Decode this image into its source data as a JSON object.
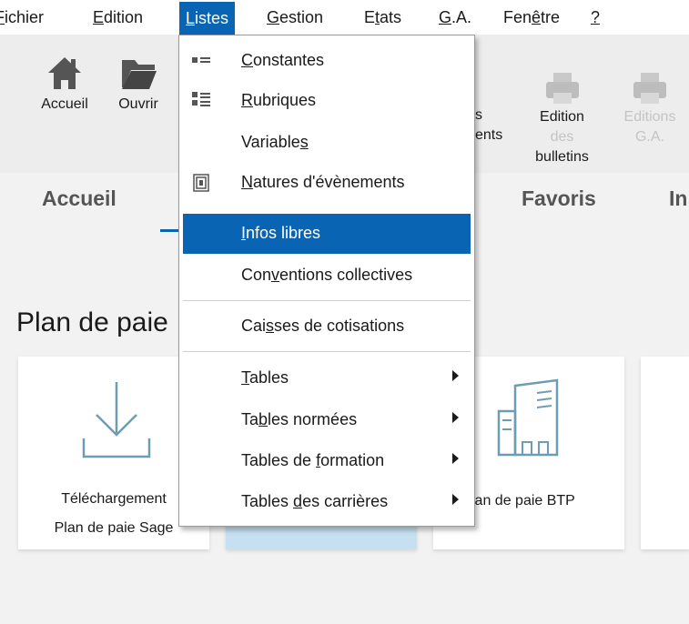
{
  "menubar": {
    "items": [
      {
        "pre": "",
        "ul": "F",
        "post": "ichier"
      },
      {
        "pre": "",
        "ul": "E",
        "post": "dition"
      },
      {
        "pre": "",
        "ul": "L",
        "post": "istes"
      },
      {
        "pre": "",
        "ul": "G",
        "post": "estion"
      },
      {
        "pre": "E",
        "ul": "t",
        "post": "ats"
      },
      {
        "pre": "",
        "ul": "G",
        "post": ".A."
      },
      {
        "pre": "Fen",
        "ul": "ê",
        "post": "tre"
      },
      {
        "pre": "",
        "ul": "?",
        "post": ""
      }
    ]
  },
  "ribbon": {
    "accueil": "Accueil",
    "ouvrir": "Ouvrir",
    "partial_1": "s",
    "partial_2": "ents",
    "edition_bulletins_1": "Edition",
    "edition_bulletins_2": "des",
    "edition_bulletins_3": "bulletins",
    "editions_ga_1": "Editions",
    "editions_ga_2": "G.A."
  },
  "tabs": {
    "accueil": "Accueil",
    "favoris": "Favoris",
    "partial": "In"
  },
  "section_title": "Plan de paie",
  "cards": {
    "telechargement_1": "Téléchargement",
    "telechargement_2": "Plan de paie Sage",
    "btp": "lan de paie BTP"
  },
  "dropdown": {
    "items": [
      {
        "pre": "",
        "ul": "C",
        "post": "onstantes",
        "icon": "constants-icon"
      },
      {
        "pre": "",
        "ul": "R",
        "post": "ubriques",
        "icon": "rubriques-icon"
      },
      {
        "pre": "Variable",
        "ul": "s",
        "post": "",
        "icon": ""
      },
      {
        "pre": "",
        "ul": "N",
        "post": "atures d'évènements",
        "icon": "event-natures-icon"
      },
      {
        "pre": "",
        "ul": "I",
        "post": "nfos libres",
        "icon": ""
      },
      {
        "pre": "Con",
        "ul": "v",
        "post": "entions collectives",
        "icon": ""
      },
      {
        "pre": "Cai",
        "ul": "s",
        "post": "ses de cotisations",
        "icon": ""
      },
      {
        "pre": "",
        "ul": "T",
        "post": "ables",
        "icon": ""
      },
      {
        "pre": "Ta",
        "ul": "b",
        "post": "les normées",
        "icon": ""
      },
      {
        "pre": "Tables de ",
        "ul": "f",
        "post": "ormation",
        "icon": ""
      },
      {
        "pre": "Tables ",
        "ul": "d",
        "post": "es carrières",
        "icon": ""
      }
    ],
    "selected_index": 4
  },
  "colors": {
    "accent": "#0a64b4",
    "selected_card": "#c5e0f0"
  }
}
